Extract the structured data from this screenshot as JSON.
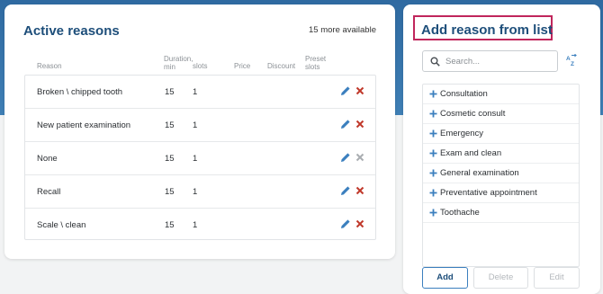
{
  "active": {
    "title": "Active reasons",
    "more_available": "15 more available",
    "columns": {
      "reason": "Reason",
      "duration_line1": "Duration,",
      "duration_line2": "min",
      "slots": "slots",
      "price": "Price",
      "discount": "Discount",
      "preset_line1": "Preset",
      "preset_line2": "slots"
    },
    "rows": [
      {
        "reason": "Broken \\ chipped tooth",
        "duration": "15",
        "slots": "1"
      },
      {
        "reason": "New patient examination",
        "duration": "15",
        "slots": "1"
      },
      {
        "reason": "None",
        "duration": "15",
        "slots": "1"
      },
      {
        "reason": "Recall",
        "duration": "15",
        "slots": "1"
      },
      {
        "reason": "Scale \\ clean",
        "duration": "15",
        "slots": "1"
      }
    ]
  },
  "list_panel": {
    "title": "Add reason from list",
    "search_placeholder": "Search...",
    "items": [
      "Consultation",
      "Cosmetic consult",
      "Emergency",
      "Exam and clean",
      "General examination",
      "Preventative appointment",
      "Toothache"
    ],
    "buttons": {
      "add": "Add",
      "delete": "Delete",
      "edit": "Edit"
    }
  },
  "colors": {
    "accent": "#3b7fbe",
    "title": "#1d4e7a",
    "delete_red": "#c0392b",
    "highlight_border": "#c0265c",
    "band": "#2f6aa1"
  },
  "icons": {
    "edit": "pencil-icon",
    "delete": "close-icon",
    "search": "search-icon",
    "sort": "sort-az-icon",
    "add_item": "plus-icon"
  }
}
